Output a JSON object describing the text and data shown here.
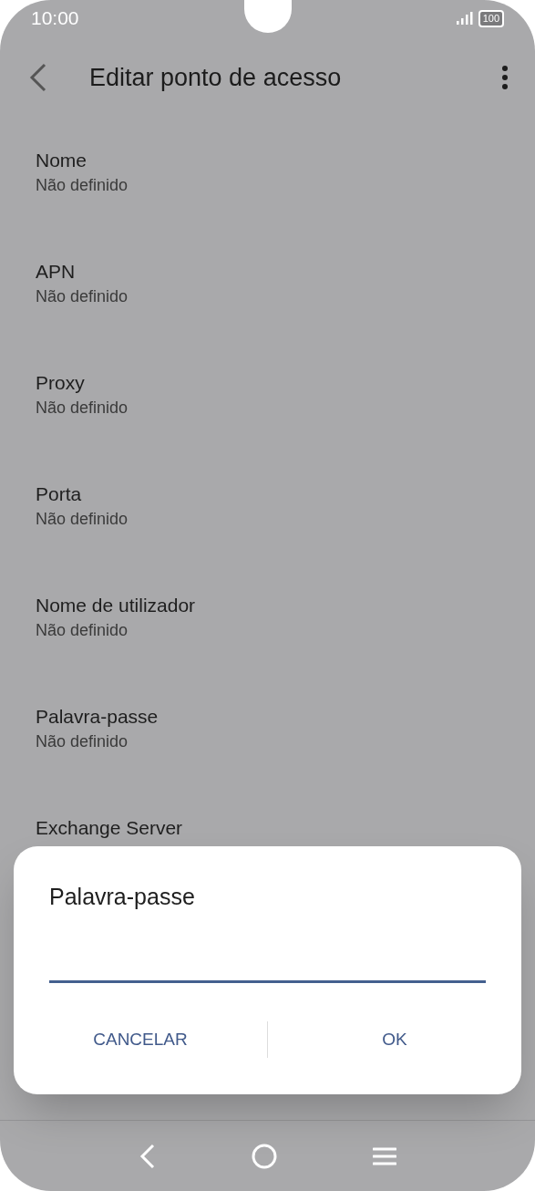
{
  "status_bar": {
    "time": "10:00",
    "battery": "100"
  },
  "app_bar": {
    "title": "Editar ponto de acesso"
  },
  "settings": [
    {
      "title": "Nome",
      "value": "Não definido"
    },
    {
      "title": "APN",
      "value": "Não definido"
    },
    {
      "title": "Proxy",
      "value": "Não definido"
    },
    {
      "title": "Porta",
      "value": "Não definido"
    },
    {
      "title": "Nome de utilizador",
      "value": "Não definido"
    },
    {
      "title": "Palavra-passe",
      "value": "Não definido"
    },
    {
      "title": "Exchange Server"
    }
  ],
  "dialog": {
    "title": "Palavra-passe",
    "buttons": [
      "CANCELAR",
      "OK"
    ]
  }
}
